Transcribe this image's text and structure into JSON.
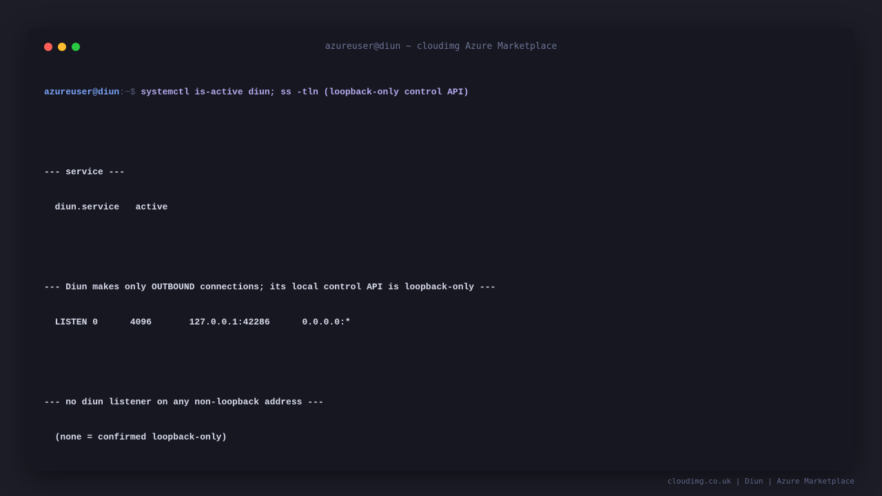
{
  "colors": {
    "background": "#1c1d27",
    "terminal_bg": "#161720",
    "dot_red": "#ff5f57",
    "dot_yellow": "#febc2e",
    "dot_green": "#28c840",
    "prompt_user": "#7aa2f7",
    "command": "#b4a9ee",
    "output": "#d6d9ea",
    "muted": "#6d7396"
  },
  "window": {
    "title": "azureuser@diun ~ cloudimg Azure Marketplace",
    "controls": [
      "close-icon",
      "minimize-icon",
      "maximize-icon"
    ]
  },
  "terminal": {
    "prompt": {
      "user_host": "azureuser@diun",
      "path_symbol": ":~$",
      "command": " systemctl is-active diun; ss -tln (loopback-only control API)"
    },
    "sections": [
      {
        "header": "--- service ---",
        "lines": [
          "  diun.service   active"
        ]
      },
      {
        "header": "--- Diun makes only OUTBOUND connections; its local control API is loopback-only ---",
        "lines": [
          "  LISTEN 0      4096       127.0.0.1:42286      0.0.0.0:*"
        ]
      },
      {
        "header": "--- no diun listener on any non-loopback address ---",
        "lines": [
          "  (none = confirmed loopback-only)"
        ]
      }
    ]
  },
  "footer": {
    "text": "cloudimg.co.uk | Diun | Azure Marketplace"
  }
}
